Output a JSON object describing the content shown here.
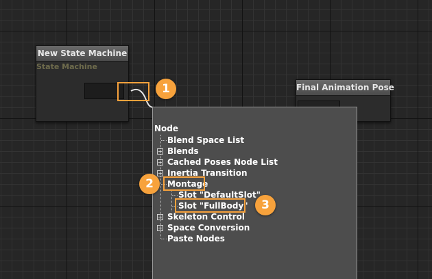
{
  "state_machine_node": {
    "title": "New State Machine",
    "subtitle": "State Machine"
  },
  "final_pose_node": {
    "title": "Final Animation Pose"
  },
  "context_menu": {
    "root_label": "Node",
    "items": [
      {
        "label": "Blend Space List",
        "expandable": false
      },
      {
        "label": "Blends",
        "expandable": true
      },
      {
        "label": "Cached Poses Node List",
        "expandable": true
      },
      {
        "label": "Inertia Transition",
        "expandable": true
      },
      {
        "label": "Montage",
        "expandable": false,
        "expanded": true
      },
      {
        "label": "Slot \"DefaultSlot\"",
        "expandable": false
      },
      {
        "label": "Slot \"FullBody\"",
        "expandable": false
      },
      {
        "label": "Skeleton Control",
        "expandable": true
      },
      {
        "label": "Space Conversion",
        "expandable": true
      },
      {
        "label": "Paste Nodes",
        "expandable": false
      }
    ]
  },
  "callouts": [
    "1",
    "2",
    "3"
  ],
  "colors": {
    "accent": "#f7a23c",
    "subtitle": "#6e6b4c"
  }
}
